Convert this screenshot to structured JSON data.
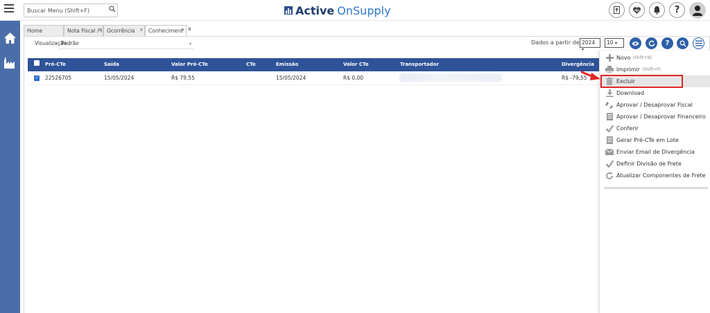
{
  "header": {
    "search_placeholder": "Buscar Menu  (Shift+F)",
    "brand_bold": "Active",
    "brand_light": "OnSupply",
    "icons": [
      "upload-icon",
      "heart-icon",
      "bell-icon",
      "help-icon",
      "user-avatar-icon"
    ]
  },
  "sidebar": {
    "icons": [
      "home-icon",
      "factory-icon"
    ]
  },
  "tabs": [
    {
      "label": "Home",
      "closable": false
    },
    {
      "label": "Nota Fiscal / I",
      "closable": true
    },
    {
      "label": "Ocorrência",
      "closable": true
    },
    {
      "label": "Conheciment",
      "closable": true
    },
    {
      "label": "x",
      "closable": false
    }
  ],
  "filters": {
    "visualizacao_label": "Visualização:",
    "visualizacao_value": "Padrão",
    "dados_label": "Dados a partir de:",
    "year": "2024",
    "page_size": "10"
  },
  "grid": {
    "columns": [
      "Pré-CTe",
      "Saída",
      "Valor Pré-CTe",
      "CTe",
      "Emissão",
      "Valor CTe",
      "Transportador",
      "Divergência"
    ],
    "rows": [
      {
        "pre_cte": "22526705",
        "saida": "15/05/2024",
        "valor_pre_cte": "R$ 79,55",
        "cte": "",
        "emissao": "15/05/2024",
        "valor_cte": "R$ 0,00",
        "transportador": "",
        "divergencia": "R$ -79,55",
        "checked": true
      }
    ]
  },
  "menu": {
    "items": [
      {
        "label": "Novo",
        "shortcut": "(Shift+N)",
        "icon": "plus-icon"
      },
      {
        "label": "Imprimir",
        "shortcut": "(Shift+P)",
        "icon": "printer-icon"
      },
      {
        "label": "Excluir",
        "shortcut": "",
        "icon": "trash-icon"
      },
      {
        "label": "Download",
        "shortcut": "",
        "icon": "download-icon"
      },
      {
        "label": "Aprovar / Desaprovar Fiscal",
        "shortcut": "",
        "icon": "thumbs-icon"
      },
      {
        "label": "Aprovar / Desaprovar Financeiro",
        "shortcut": "",
        "icon": "document-icon"
      },
      {
        "label": "Conferir",
        "shortcut": "",
        "icon": "check-icon"
      },
      {
        "label": "Gerar Pré-CTe em Lote",
        "shortcut": "",
        "icon": "document-icon"
      },
      {
        "label": "Enviar Email de Divergência",
        "shortcut": "",
        "icon": "envelope-icon"
      },
      {
        "label": "Definir Divisão de Frete",
        "shortcut": "",
        "icon": "check-icon"
      },
      {
        "label": "Atualizar Componentes de Frete",
        "shortcut": "",
        "icon": "refresh-icon"
      }
    ]
  },
  "colors": {
    "sidebar": "#4a6ea8",
    "grid_header": "#2e5398",
    "highlight_border": "#e02525",
    "accent": "#2d5fa8"
  }
}
